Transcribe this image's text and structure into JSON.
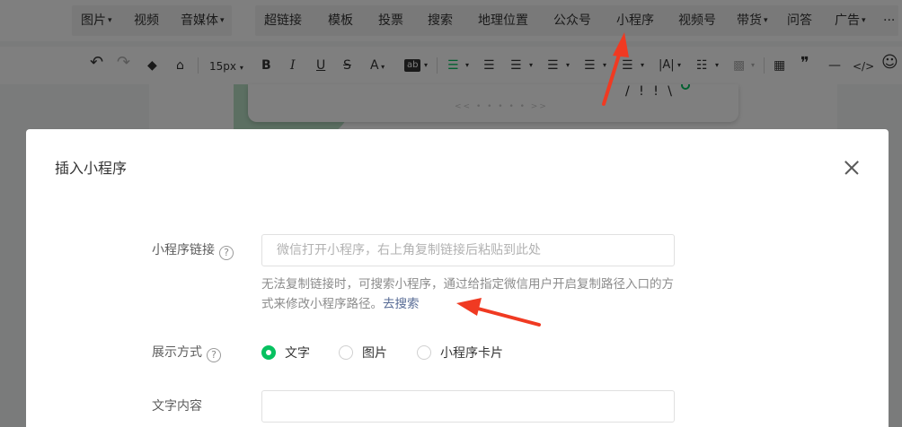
{
  "menubar": {
    "items": [
      {
        "label": "图片",
        "dropdown": true
      },
      {
        "label": "视频",
        "dropdown": false
      },
      {
        "label": "音媒体",
        "dropdown": true
      },
      {
        "label": "超链接",
        "dropdown": false
      },
      {
        "label": "模板",
        "dropdown": false
      },
      {
        "label": "投票",
        "dropdown": false
      },
      {
        "label": "搜索",
        "dropdown": false
      },
      {
        "label": "地理位置",
        "dropdown": false
      },
      {
        "label": "公众号",
        "dropdown": false
      },
      {
        "label": "小程序",
        "dropdown": false
      },
      {
        "label": "视频号",
        "dropdown": false
      },
      {
        "label": "带货",
        "dropdown": true
      },
      {
        "label": "问答",
        "dropdown": false
      },
      {
        "label": "广告",
        "dropdown": true
      },
      {
        "label": "···",
        "dropdown": false
      }
    ]
  },
  "toolbar": {
    "undo": "↶",
    "redo": "↷",
    "font_size": "15px",
    "bold": "B",
    "italic": "I",
    "underline": "U",
    "strike": "S",
    "font_color": "A",
    "bg_color": "ab",
    "letter_spacing": "|A|",
    "quote": "❞",
    "hr": "—",
    "code": "</>",
    "emoji": "☺"
  },
  "dialog": {
    "title": "插入小程序",
    "link_label": "小程序链接",
    "link_placeholder": "微信打开小程序，右上角复制链接后粘贴到此处",
    "link_value": "",
    "hint_text": "无法复制链接时，可搜索小程序，通过给指定微信用户开启复制路径入口的方式来修改小程序路径。",
    "hint_link": "去搜索",
    "display_label": "展示方式",
    "display_options": [
      {
        "label": "文字",
        "selected": true
      },
      {
        "label": "图片",
        "selected": false
      },
      {
        "label": "小程序卡片",
        "selected": false
      }
    ],
    "text_label": "文字内容",
    "text_value": ""
  },
  "colors": {
    "accent_green": "#07c160",
    "link_blue": "#576b95",
    "annotation_red": "#f03a22"
  }
}
